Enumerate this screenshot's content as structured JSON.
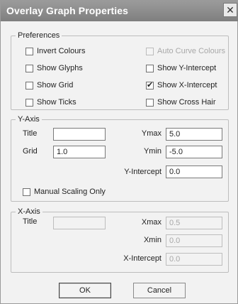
{
  "window": {
    "title": "Overlay Graph Properties"
  },
  "preferences": {
    "legend": "Preferences",
    "left": [
      {
        "label": "Invert Colours",
        "checked": false,
        "disabled": false
      },
      {
        "label": "Show Glyphs",
        "checked": false,
        "disabled": false
      },
      {
        "label": "Show Grid",
        "checked": false,
        "disabled": false
      },
      {
        "label": "Show Ticks",
        "checked": false,
        "disabled": false
      }
    ],
    "right": [
      {
        "label": "Auto Curve Colours",
        "checked": false,
        "disabled": true
      },
      {
        "label": "Show Y-Intercept",
        "checked": false,
        "disabled": false
      },
      {
        "label": "Show X-Intercept",
        "checked": true,
        "disabled": false
      },
      {
        "label": "Show Cross Hair",
        "checked": false,
        "disabled": false
      }
    ]
  },
  "y_axis": {
    "legend": "Y-Axis",
    "title_label": "Title",
    "title_value": "",
    "grid_label": "Grid",
    "grid_value": "1.0",
    "ymax_label": "Ymax",
    "ymax_value": "5.0",
    "ymin_label": "Ymin",
    "ymin_value": "-5.0",
    "yintercept_label": "Y-Intercept",
    "yintercept_value": "0.0",
    "manual_scaling_label": "Manual Scaling Only",
    "manual_scaling_checked": false
  },
  "x_axis": {
    "legend": "X-Axis",
    "title_label": "Title",
    "title_value": "",
    "xmax_label": "Xmax",
    "xmax_value": "0.5",
    "xmin_label": "Xmin",
    "xmin_value": "0.0",
    "xintercept_label": "X-Intercept",
    "xintercept_value": "0.0"
  },
  "buttons": {
    "ok": "OK",
    "cancel": "Cancel"
  },
  "icons": {
    "close": "close-icon",
    "check": "check-icon"
  }
}
